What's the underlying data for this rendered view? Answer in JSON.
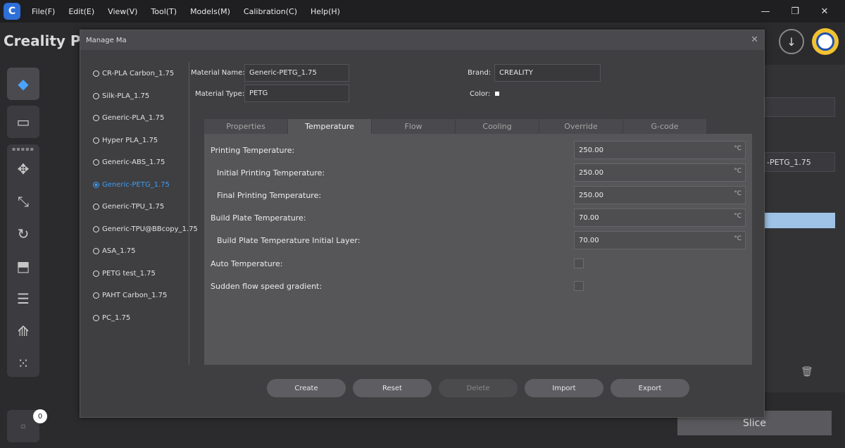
{
  "menubar": {
    "items": [
      "File(F)",
      "Edit(E)",
      "View(V)",
      "Tool(T)",
      "Models(M)",
      "Calibration(C)",
      "Help(H)"
    ]
  },
  "app": {
    "title_partial": "Creality Prin",
    "right_material_partial": "-PETG_1.75",
    "notification_count": "0",
    "slice_label": "Slice"
  },
  "dialog": {
    "title_partial": "Manage Ma",
    "materials": [
      {
        "name": "CR-PLA Carbon_1.75",
        "selected": false
      },
      {
        "name": "Silk-PLA_1.75",
        "selected": false
      },
      {
        "name": "Generic-PLA_1.75",
        "selected": false
      },
      {
        "name": "Hyper PLA_1.75",
        "selected": false
      },
      {
        "name": "Generic-ABS_1.75",
        "selected": false
      },
      {
        "name": "Generic-PETG_1.75",
        "selected": true
      },
      {
        "name": "Generic-TPU_1.75",
        "selected": false
      },
      {
        "name": "Generic-TPU@BBcopy_1.75",
        "selected": false
      },
      {
        "name": "ASA_1.75",
        "selected": false
      },
      {
        "name": "PETG test_1.75",
        "selected": false
      },
      {
        "name": "PAHT Carbon_1.75",
        "selected": false
      },
      {
        "name": "PC_1.75",
        "selected": false
      }
    ],
    "form": {
      "material_name_label": "Material Name:",
      "material_name_value": "Generic-PETG_1.75",
      "material_type_label": "Material Type:",
      "material_type_value": "PETG",
      "brand_label": "Brand:",
      "brand_value": "CREALITY",
      "color_label": "Color:",
      "color_value": "#ffffff"
    },
    "tabs": [
      {
        "label": "Properties",
        "active": false
      },
      {
        "label": "Temperature",
        "active": true
      },
      {
        "label": "Flow",
        "active": false
      },
      {
        "label": "Cooling",
        "active": false
      },
      {
        "label": "Override",
        "active": false
      },
      {
        "label": "G-code",
        "active": false
      }
    ],
    "temperature": {
      "rows": [
        {
          "label": "Printing Temperature:",
          "value": "250.00",
          "unit": "°C",
          "indent": false
        },
        {
          "label": "Initial Printing Temperature:",
          "value": "250.00",
          "unit": "°C",
          "indent": true
        },
        {
          "label": "Final Printing Temperature:",
          "value": "250.00",
          "unit": "°C",
          "indent": true
        },
        {
          "label": "Build Plate Temperature:",
          "value": "70.00",
          "unit": "°C",
          "indent": false
        },
        {
          "label": "Build Plate Temperature Initial Layer:",
          "value": "70.00",
          "unit": "°C",
          "indent": true
        }
      ],
      "auto_temperature_label": "Auto Temperature:",
      "auto_temperature_checked": false,
      "sudden_flow_label": "Sudden flow speed gradient:",
      "sudden_flow_checked": false
    },
    "buttons": {
      "create": "Create",
      "reset": "Reset",
      "delete": "Delete",
      "import": "Import",
      "export": "Export"
    }
  }
}
